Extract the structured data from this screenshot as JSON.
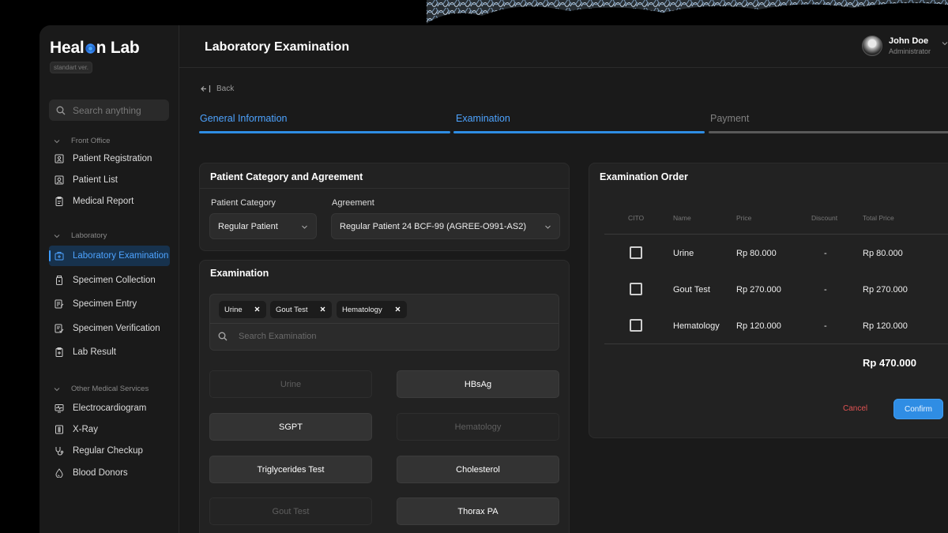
{
  "brand": {
    "name_part1": "Heal",
    "name_part2": "n Lab",
    "version": "standart ver."
  },
  "search": {
    "placeholder": "Search anything"
  },
  "sidebar": {
    "sections": [
      {
        "title": "Front Office",
        "items": [
          "Patient Registration",
          "Patient List",
          "Medical Report"
        ]
      },
      {
        "title": "Laboratory",
        "items": [
          "Laboratory Examination",
          "Specimen Collection",
          "Specimen Entry",
          "Specimen Verification",
          "Lab Result"
        ]
      },
      {
        "title": "Other Medical Services",
        "items": [
          "Electrocardiogram",
          "X-Ray",
          "Regular Checkup",
          "Blood Donors"
        ]
      }
    ],
    "active_item": "Laboratory Examination"
  },
  "header": {
    "title": "Laboratory Examination"
  },
  "user": {
    "name": "John Doe",
    "role": "Administrator"
  },
  "back_label": "Back",
  "steps": [
    {
      "label": "General Information",
      "state": "done"
    },
    {
      "label": "Examination",
      "state": "active"
    },
    {
      "label": "Payment",
      "state": "pending"
    }
  ],
  "category_card": {
    "title": "Patient Category and Agreement",
    "category_label": "Patient Category",
    "category_value": "Regular Patient",
    "agreement_label": "Agreement",
    "agreement_value": "Regular Patient 24 BCF-99 (AGREE-O991-AS2)"
  },
  "examination_card": {
    "title": "Examination",
    "selected": [
      "Urine",
      "Gout Test",
      "Hematology"
    ],
    "search_placeholder": "Search Examination",
    "options": [
      {
        "label": "Urine",
        "enabled": false
      },
      {
        "label": "HBsAg",
        "enabled": true
      },
      {
        "label": "SGPT",
        "enabled": true
      },
      {
        "label": "Hematology",
        "enabled": false
      },
      {
        "label": "Triglycerides Test",
        "enabled": true
      },
      {
        "label": "Cholesterol",
        "enabled": true
      },
      {
        "label": "Gout Test",
        "enabled": false
      },
      {
        "label": "Thorax PA",
        "enabled": true
      }
    ]
  },
  "order_card": {
    "title": "Examination Order",
    "columns": [
      "CITO",
      "Name",
      "Price",
      "Discount",
      "Total Price"
    ],
    "rows": [
      {
        "cito": false,
        "name": "Urine",
        "price": "Rp 80.000",
        "discount": "-",
        "total": "Rp 80.000"
      },
      {
        "cito": false,
        "name": "Gout Test",
        "price": "Rp 270.000",
        "discount": "-",
        "total": "Rp 270.000"
      },
      {
        "cito": false,
        "name": "Hematology",
        "price": "Rp 120.000",
        "discount": "-",
        "total": "Rp 120.000"
      }
    ],
    "grand_total": "Rp 470.000",
    "cancel_label": "Cancel",
    "confirm_label": "Confirm"
  },
  "colors": {
    "accent": "#2f8de4",
    "active_text": "#4da3ff",
    "cancel": "#e25353",
    "background": "#1a1a1a"
  }
}
